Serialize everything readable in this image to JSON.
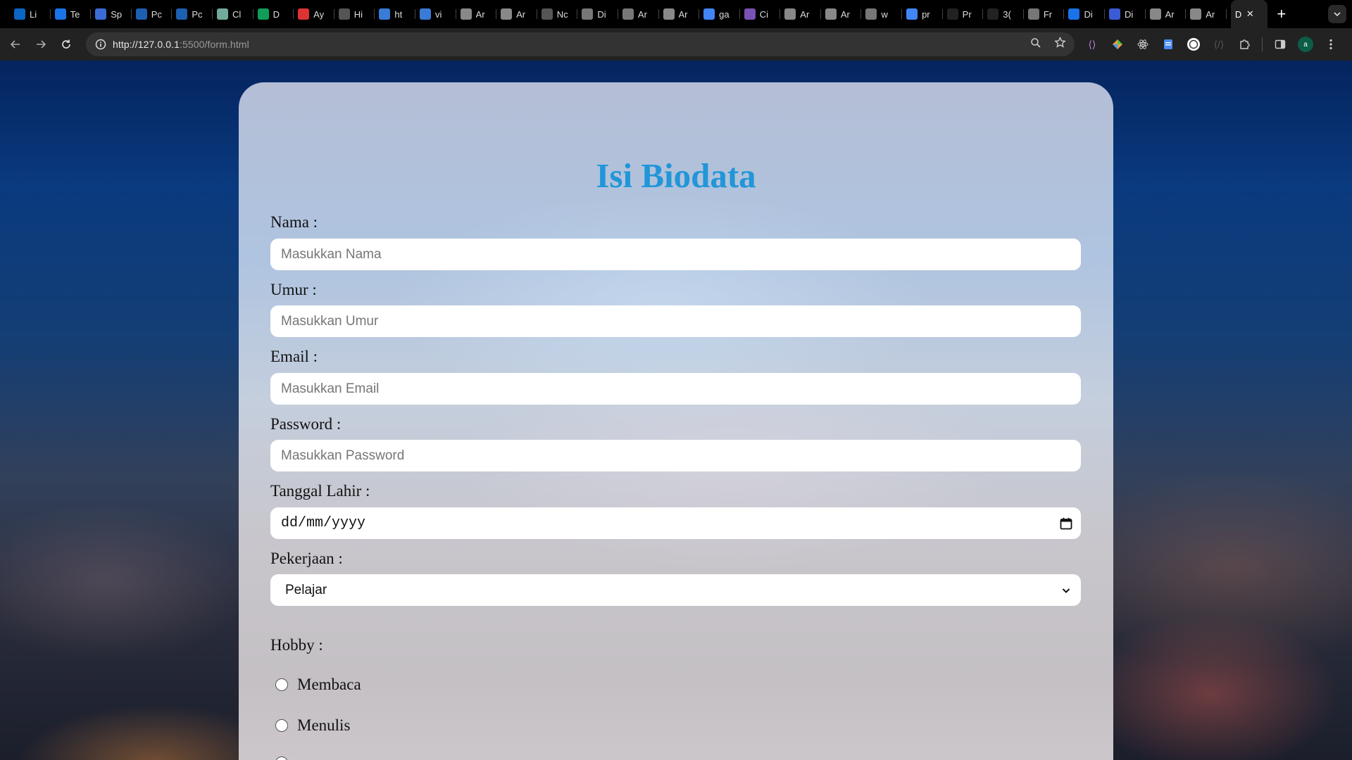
{
  "browser": {
    "tabs": [
      {
        "label": "Li",
        "icon": "linkedin-icon",
        "color": "#0a66c2"
      },
      {
        "label": "Te",
        "icon": "c-logo-icon",
        "color": "#1a73e8"
      },
      {
        "label": "Sp",
        "icon": "printer-icon",
        "color": "#3b6bd6"
      },
      {
        "label": "Pc",
        "icon": "brand-icon",
        "color": "#1d5fb0"
      },
      {
        "label": "Pc",
        "icon": "brand-icon",
        "color": "#1d5fb0"
      },
      {
        "label": "Cl",
        "icon": "chatgpt-icon",
        "color": "#74aa9c"
      },
      {
        "label": "D",
        "icon": "sheets-icon",
        "color": "#0f9d58"
      },
      {
        "label": "Ay",
        "icon": "chart-icon",
        "color": "#d33"
      },
      {
        "label": "Hi",
        "icon": "page-icon",
        "color": "#555"
      },
      {
        "label": "ht",
        "icon": "edit-icon",
        "color": "#3a7bd5"
      },
      {
        "label": "vi",
        "icon": "edit-icon",
        "color": "#3a7bd5"
      },
      {
        "label": "Ar",
        "icon": "wave-icon",
        "color": "#888"
      },
      {
        "label": "Ar",
        "icon": "wave-icon",
        "color": "#888"
      },
      {
        "label": "Nc",
        "icon": "github-icon",
        "color": "#555"
      },
      {
        "label": "Di",
        "icon": "globe-icon",
        "color": "#777"
      },
      {
        "label": "Ar",
        "icon": "globe-icon",
        "color": "#777"
      },
      {
        "label": "Ar",
        "icon": "wave-icon",
        "color": "#888"
      },
      {
        "label": "ga",
        "icon": "google-icon",
        "color": "#4285f4"
      },
      {
        "label": "Ci",
        "icon": "bootstrap-icon",
        "color": "#7952b3"
      },
      {
        "label": "Ar",
        "icon": "wave-icon",
        "color": "#888"
      },
      {
        "label": "Ar",
        "icon": "wave-icon",
        "color": "#888"
      },
      {
        "label": "w",
        "icon": "globe-icon",
        "color": "#777"
      },
      {
        "label": "pr",
        "icon": "google-icon",
        "color": "#4285f4"
      },
      {
        "label": "Pr",
        "icon": "st-icon",
        "color": "#222"
      },
      {
        "label": "3(",
        "icon": "st-icon",
        "color": "#222"
      },
      {
        "label": "Fr",
        "icon": "globe-icon",
        "color": "#777"
      },
      {
        "label": "Di",
        "icon": "c-logo-icon",
        "color": "#1a73e8"
      },
      {
        "label": "Di",
        "icon": "app-icon",
        "color": "#3b5bd6"
      },
      {
        "label": "Ar",
        "icon": "wave-icon",
        "color": "#888"
      },
      {
        "label": "Ar",
        "icon": "wave-icon",
        "color": "#888"
      }
    ],
    "active_tab": {
      "label": "D",
      "close": "✕"
    },
    "new_tab": "+",
    "url_host": "http://127.0.0.1",
    "url_path": ":5500/form.html",
    "profile_initial": "a"
  },
  "form": {
    "title": "Isi Biodata",
    "fields": {
      "nama": {
        "label": "Nama :",
        "placeholder": "Masukkan Nama"
      },
      "umur": {
        "label": "Umur :",
        "placeholder": "Masukkan Umur"
      },
      "email": {
        "label": "Email :",
        "placeholder": "Masukkan Email"
      },
      "password": {
        "label": "Password :",
        "placeholder": "Masukkan Password"
      },
      "tanggal": {
        "label": "Tanggal Lahir :",
        "value": "dd/mm/yyyy"
      },
      "pekerjaan": {
        "label": "Pekerjaan :",
        "value": "Pelajar"
      }
    },
    "hobby": {
      "label": "Hobby :",
      "options": [
        "Membaca",
        "Menulis"
      ]
    },
    "colors": {
      "title": "#2196d8",
      "field_bg": "#ffffff"
    }
  }
}
